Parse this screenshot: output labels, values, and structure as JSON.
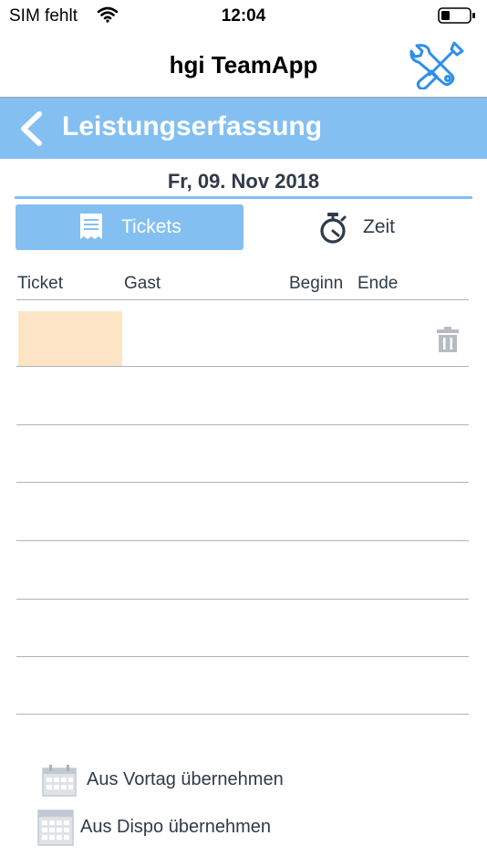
{
  "status_bar": {
    "carrier": "SIM fehlt",
    "time": "12:04"
  },
  "header": {
    "title": "hgi TeamApp"
  },
  "section": {
    "title": "Leistungserfassung"
  },
  "date": "Fr, 09. Nov 2018",
  "tabs": [
    {
      "label": "Tickets",
      "icon": "receipt-icon",
      "active": true
    },
    {
      "label": "Zeit",
      "icon": "stopwatch-icon",
      "active": false
    }
  ],
  "table": {
    "columns": [
      "Ticket",
      "Gast",
      "Beginn",
      "Ende"
    ],
    "rows": [
      {
        "ticket": "",
        "gast": "",
        "beginn": "",
        "ende": ""
      }
    ]
  },
  "actions": [
    {
      "label": "Aus Vortag übernehmen",
      "icon": "calendar-icon"
    },
    {
      "label": "Aus Dispo übernehmen",
      "icon": "calendar-grid-icon"
    }
  ],
  "colors": {
    "accent": "#84bff1",
    "ticket_highlight": "#fde4c5",
    "text": "#2f3a4a"
  }
}
